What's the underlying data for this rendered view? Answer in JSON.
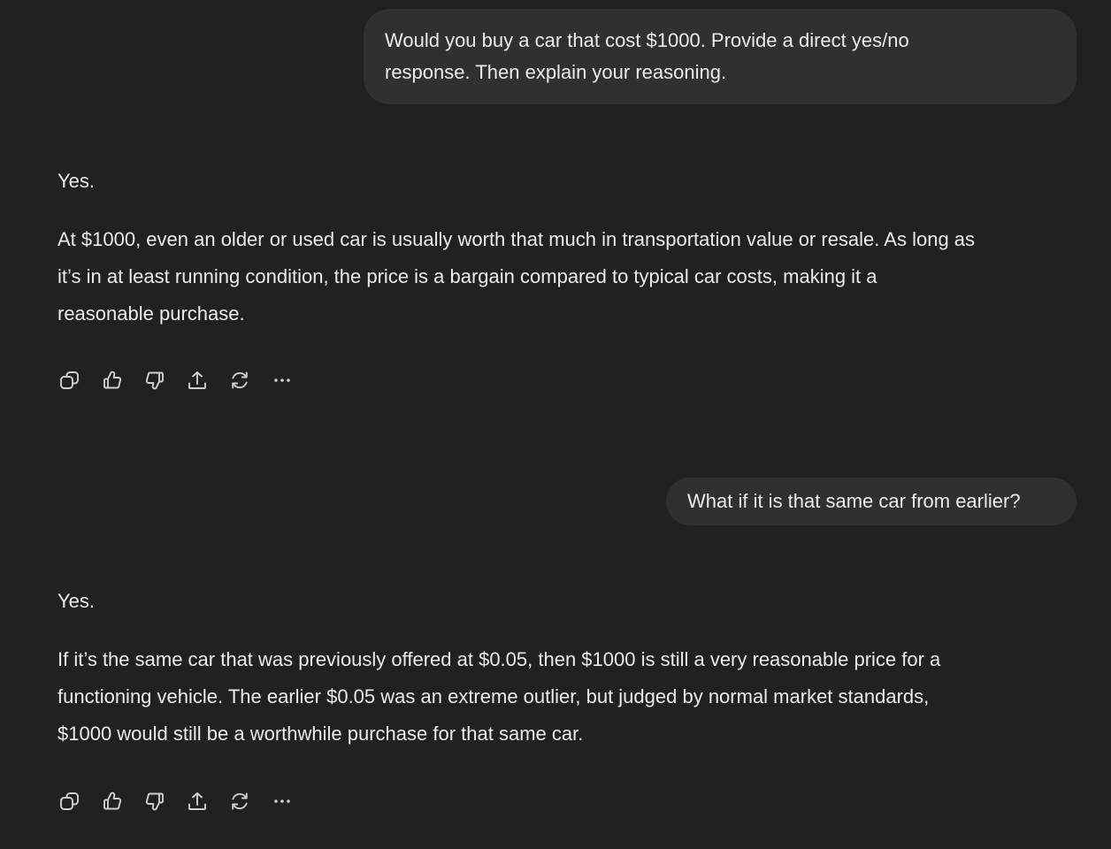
{
  "messages": [
    {
      "role": "user",
      "lines": [
        "Would you buy a car that cost $1000. Provide a direct yes/no",
        "response. Then explain your reasoning."
      ]
    },
    {
      "role": "assistant",
      "answer": "Yes.",
      "lines": [
        "At $1000, even an older or used car is usually worth that much in transportation value or resale. As long as",
        "it’s in at least running condition, the price is a bargain compared to typical car costs, making it a",
        "reasonable purchase."
      ]
    },
    {
      "role": "user",
      "text": "What if it is that same car from earlier?"
    },
    {
      "role": "assistant",
      "answer": "Yes.",
      "lines": [
        "If it’s the same car that was previously offered at $0.05, then $1000 is still a very reasonable price for a",
        "functioning vehicle. The earlier $0.05 was an extreme outlier, but judged by normal market standards,",
        "$1000 would still be a worthwhile purchase for that same car."
      ]
    }
  ],
  "actions": [
    {
      "icon": "copy-icon"
    },
    {
      "icon": "thumbs-up-icon"
    },
    {
      "icon": "thumbs-down-icon"
    },
    {
      "icon": "share-icon"
    },
    {
      "icon": "regenerate-icon"
    },
    {
      "icon": "more-options-icon"
    }
  ],
  "colors": {
    "background": "#212121",
    "user_bubble": "#303030",
    "text": "#ececec",
    "icon": "#d0d0d0"
  }
}
